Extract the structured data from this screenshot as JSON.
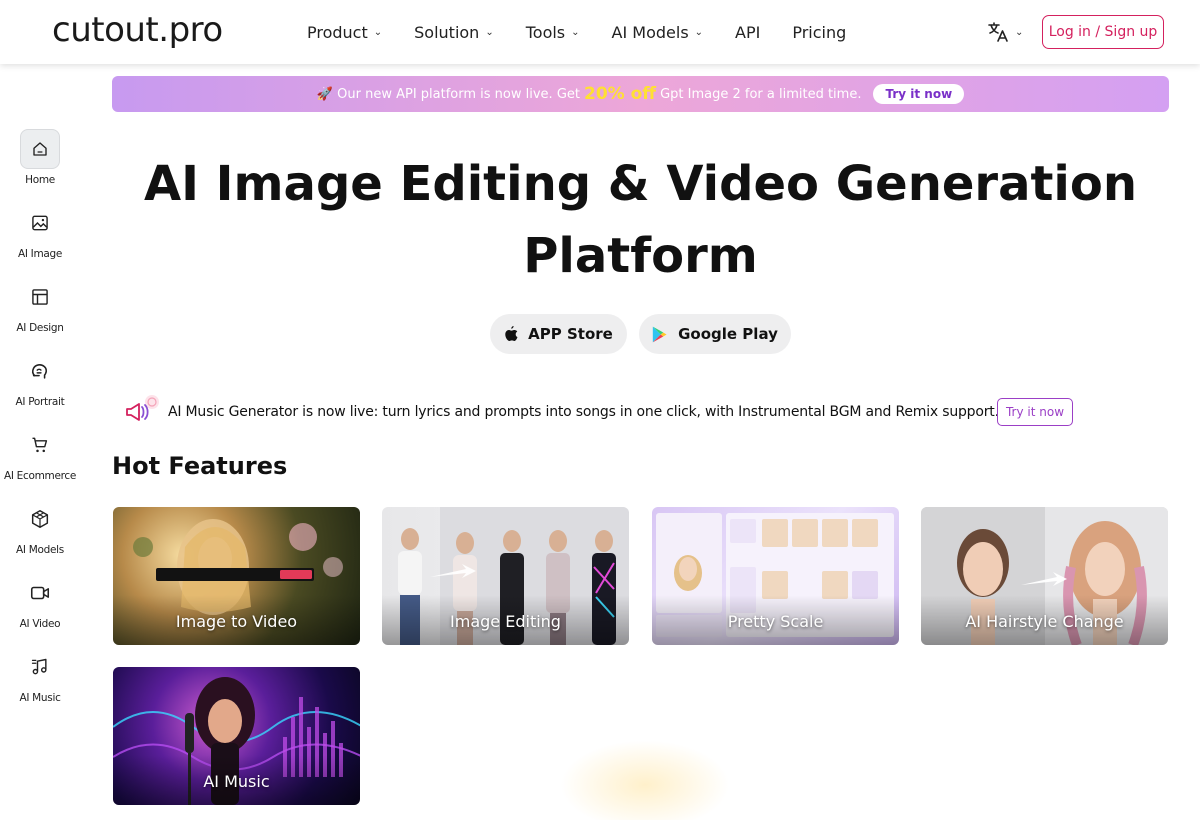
{
  "header": {
    "logo": "cutout.pro",
    "nav": [
      {
        "label": "Product",
        "dropdown": true
      },
      {
        "label": "Solution",
        "dropdown": true
      },
      {
        "label": "Tools",
        "dropdown": true
      },
      {
        "label": "AI Models",
        "dropdown": true
      },
      {
        "label": "API",
        "dropdown": false
      },
      {
        "label": "Pricing",
        "dropdown": false
      }
    ],
    "language_icon": "translate-icon",
    "login_label": "Log in / Sign up"
  },
  "sidebar": {
    "items": [
      {
        "label": "Home",
        "icon": "home-icon",
        "active": true
      },
      {
        "label": "AI Image",
        "icon": "image-icon"
      },
      {
        "label": "AI Design",
        "icon": "layout-icon"
      },
      {
        "label": "AI Portrait",
        "icon": "portrait-icon"
      },
      {
        "label": "AI Ecommerce",
        "icon": "cart-icon"
      },
      {
        "label": "AI Models",
        "icon": "cube-icon"
      },
      {
        "label": "AI Video",
        "icon": "video-icon"
      },
      {
        "label": "AI Music",
        "icon": "music-icon"
      }
    ]
  },
  "banner": {
    "prefix": "🚀 Our new API platform is now live. Get",
    "highlight": "20% off",
    "suffix": "Gpt Image 2 for a limited time.",
    "button": "Try it now",
    "colors": {
      "highlight": "#ffe033",
      "button_text": "#7a30c8"
    }
  },
  "hero": {
    "title_line1": "AI Image Editing & Video Generation",
    "title_line2": "Platform",
    "app_store": "APP Store",
    "google_play": "Google Play"
  },
  "notice": {
    "icon": "megaphone-icon",
    "text": "AI Music Generator is now live: turn lyrics and prompts into songs in one click, with Instrumental BGM and Remix support.",
    "button": "Try it now"
  },
  "hot_features": {
    "title": "Hot Features",
    "cards": [
      {
        "label": "Image to Video"
      },
      {
        "label": "Image Editing"
      },
      {
        "label": "Pretty Scale"
      },
      {
        "label": "AI Hairstyle Change"
      },
      {
        "label": "AI Music"
      }
    ]
  },
  "colors": {
    "brand_pink": "#d4215e",
    "accent_purple": "#9b3fc6"
  }
}
